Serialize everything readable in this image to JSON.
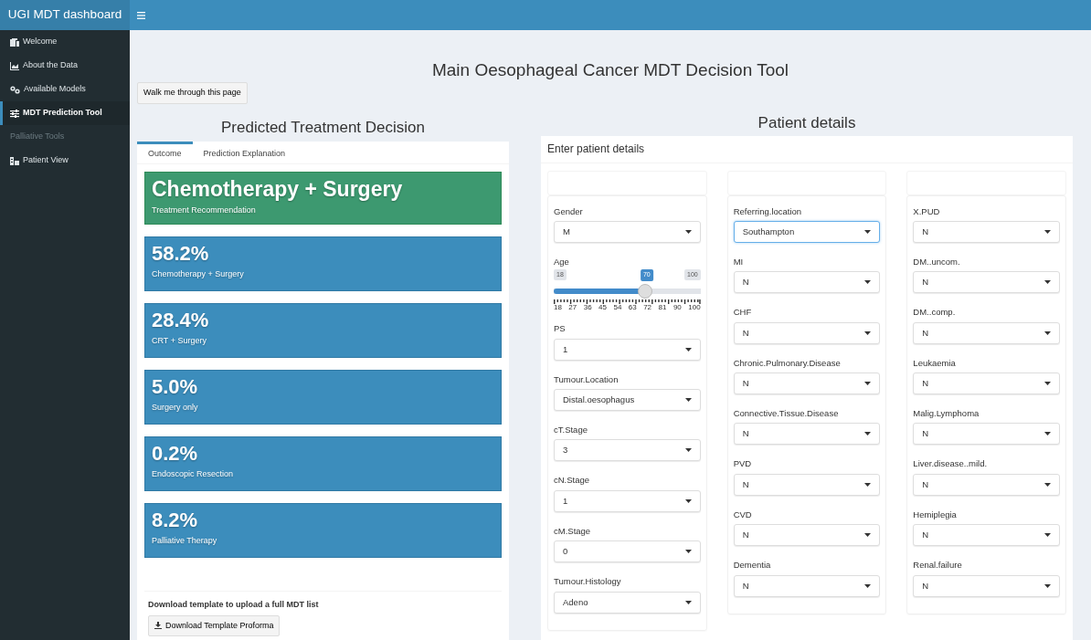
{
  "header": {
    "title": "UGI MDT dashboard"
  },
  "sidebar": {
    "items": [
      {
        "label": "Welcome",
        "selected": false,
        "disabled": false
      },
      {
        "label": "About the Data",
        "selected": false,
        "disabled": false
      },
      {
        "label": "Available Models",
        "selected": false,
        "disabled": false
      },
      {
        "label": "MDT Prediction Tool",
        "selected": true,
        "disabled": false
      },
      {
        "label": "Palliative Tools",
        "selected": false,
        "disabled": true
      },
      {
        "label": "Patient View",
        "selected": false,
        "disabled": false
      }
    ]
  },
  "page_title": "Main Oesophageal Cancer MDT Decision Tool",
  "walkthrough_button": "Walk me through this page",
  "prediction": {
    "title": "Predicted Treatment Decision",
    "tabs": [
      {
        "label": "Outcome",
        "selected": true
      },
      {
        "label": "Prediction Explanation",
        "selected": false
      }
    ],
    "recommendation": {
      "value": "Chemotherapy + Surgery",
      "label": "Treatment Recommendation"
    },
    "probabilities": [
      {
        "value": "58.2%",
        "label": "Chemotherapy + Surgery"
      },
      {
        "value": "28.4%",
        "label": "CRT + Surgery"
      },
      {
        "value": "5.0%",
        "label": "Surgery only"
      },
      {
        "value": "0.2%",
        "label": "Endoscopic Resection"
      },
      {
        "value": "8.2%",
        "label": "Palliative Therapy"
      }
    ],
    "download": {
      "text": "Download template to upload a full MDT list",
      "button": "Download Template Proforma"
    }
  },
  "patient": {
    "title": "Patient details",
    "panel_title": "Enter patient details",
    "columns": [
      [
        {
          "kind": "select",
          "label": "Gender",
          "value": "M",
          "focused": false
        },
        {
          "kind": "slider",
          "label": "Age",
          "min": "18",
          "max": "100",
          "value": "70",
          "level": 0.634,
          "ticks": [
            "18",
            "27",
            "36",
            "45",
            "54",
            "63",
            "72",
            "81",
            "90",
            "100"
          ]
        },
        {
          "kind": "select",
          "label": "PS",
          "value": "1",
          "focused": false
        },
        {
          "kind": "select",
          "label": "Tumour.Location",
          "value": "Distal.oesophagus",
          "focused": false
        },
        {
          "kind": "select",
          "label": "cT.Stage",
          "value": "3",
          "focused": false
        },
        {
          "kind": "select",
          "label": "cN.Stage",
          "value": "1",
          "focused": false
        },
        {
          "kind": "select",
          "label": "cM.Stage",
          "value": "0",
          "focused": false
        },
        {
          "kind": "select",
          "label": "Tumour.Histology",
          "value": "Adeno",
          "focused": false
        }
      ],
      [
        {
          "kind": "select",
          "label": "Referring.location",
          "value": "Southampton",
          "focused": true
        },
        {
          "kind": "select",
          "label": "MI",
          "value": "N",
          "focused": false
        },
        {
          "kind": "select",
          "label": "CHF",
          "value": "N",
          "focused": false
        },
        {
          "kind": "select",
          "label": "Chronic.Pulmonary.Disease",
          "value": "N",
          "focused": false
        },
        {
          "kind": "select",
          "label": "Connective.Tissue.Disease",
          "value": "N",
          "focused": false
        },
        {
          "kind": "select",
          "label": "PVD",
          "value": "N",
          "focused": false
        },
        {
          "kind": "select",
          "label": "CVD",
          "value": "N",
          "focused": false
        },
        {
          "kind": "select",
          "label": "Dementia",
          "value": "N",
          "focused": false
        }
      ],
      [
        {
          "kind": "select",
          "label": "X.PUD",
          "value": "N",
          "focused": false
        },
        {
          "kind": "select",
          "label": "DM..uncom.",
          "value": "N",
          "focused": false
        },
        {
          "kind": "select",
          "label": "DM..comp.",
          "value": "N",
          "focused": false
        },
        {
          "kind": "select",
          "label": "Leukaemia",
          "value": "N",
          "focused": false
        },
        {
          "kind": "select",
          "label": "Malig.Lymphoma",
          "value": "N",
          "focused": false
        },
        {
          "kind": "select",
          "label": "Liver.disease..mild.",
          "value": "N",
          "focused": false
        },
        {
          "kind": "select",
          "label": "Hemiplegia",
          "value": "N",
          "focused": false
        },
        {
          "kind": "select",
          "label": "Renal.failure",
          "value": "N",
          "focused": false
        }
      ]
    ]
  }
}
